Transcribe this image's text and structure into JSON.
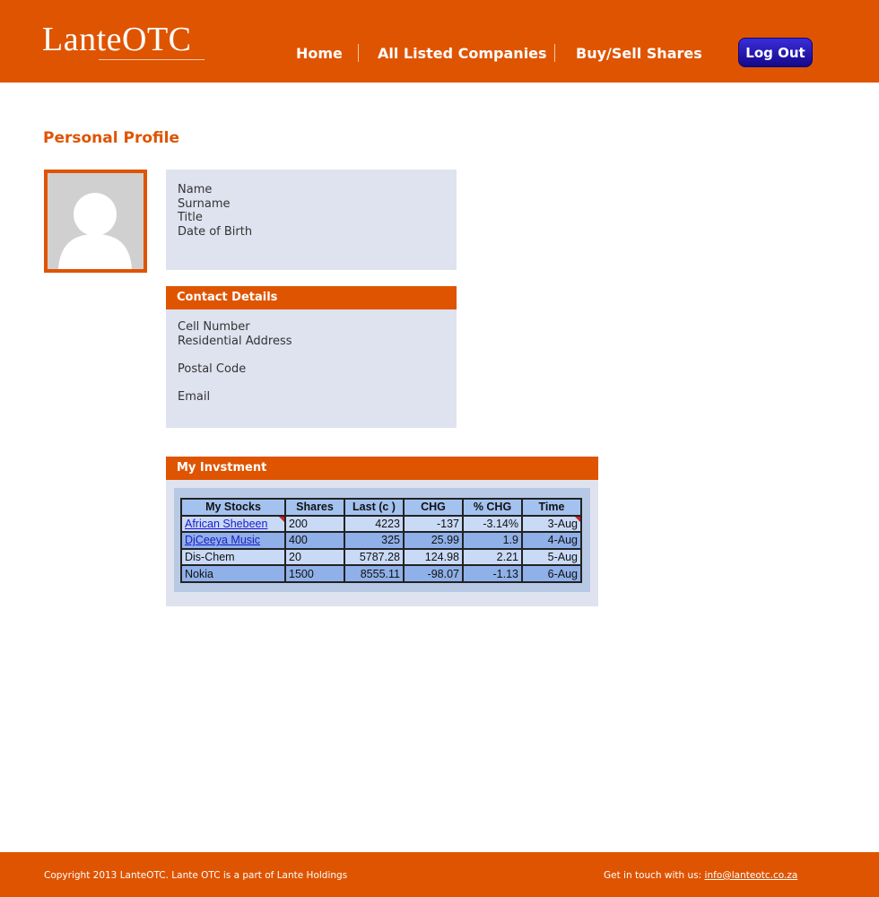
{
  "brand": {
    "logo_text": "LanteOTC"
  },
  "nav": {
    "items": [
      {
        "label": "Home"
      },
      {
        "label": "All Listed Companies"
      },
      {
        "label": "Buy/Sell Shares"
      }
    ],
    "logout_label": "Log Out"
  },
  "page": {
    "title": "Personal Profile"
  },
  "profile": {
    "fields": [
      "Name",
      "Surname",
      "Title",
      "Date of Birth"
    ]
  },
  "contact": {
    "heading": "Contact Details",
    "fields": [
      "Cell Number",
      "Residential Address",
      "",
      "Postal Code",
      "",
      "Email"
    ]
  },
  "investment": {
    "heading": "My Invstment",
    "columns": [
      "My Stocks",
      "Shares",
      "Last (c  )",
      "CHG",
      "% CHG",
      "Time"
    ],
    "rows": [
      [
        "African Shebeen",
        "200",
        "4223",
        "-137",
        "-3.14%",
        "3-Aug"
      ],
      [
        "DjCeeya Music",
        "400",
        "325",
        "25.99",
        "1.9",
        "4-Aug"
      ],
      [
        "Dis-Chem",
        "20",
        "5787.28",
        "124.98",
        "2.21",
        "5-Aug"
      ],
      [
        "Nokia",
        "1500",
        "8555.11",
        "-98.07",
        "-1.13",
        "6-Aug"
      ]
    ]
  },
  "footer": {
    "copyright": "Copyright 2013 LanteOTC. Lante OTC is a part of Lante Holdings",
    "contact_label": "Get in touch with us:",
    "email": "info@lanteotc.co.za"
  },
  "colors": {
    "brand_orange": "#df5400",
    "logout_blue": "#14088a",
    "panel_bg": "#dfe3ef"
  }
}
